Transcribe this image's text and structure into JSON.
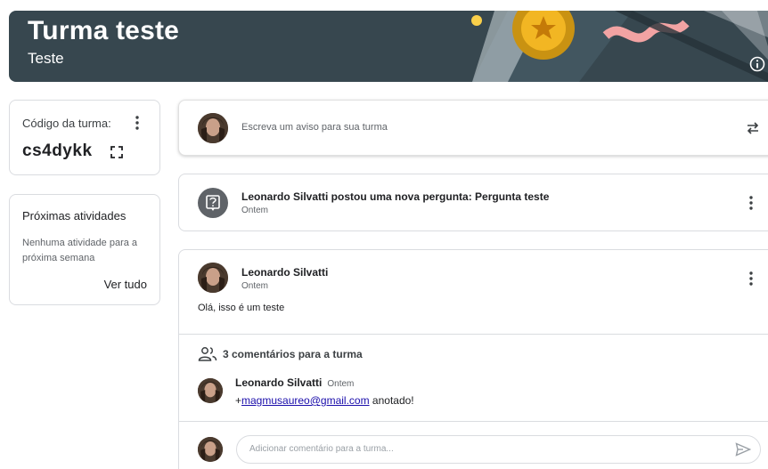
{
  "banner": {
    "title": "Turma teste",
    "subtitle": "Teste",
    "colors": {
      "background": "#37474f",
      "gold": "#e0a81f",
      "ribbon": "#f2a3a3"
    },
    "info_icon": "info-icon"
  },
  "class_code": {
    "label": "Código da turma:",
    "code": "cs4dykk",
    "icons": [
      "more-vert-icon",
      "fullscreen-icon"
    ]
  },
  "upcoming": {
    "label": "Próximas atividades",
    "empty_text": "Nenhuma atividade para a próxima semana",
    "see_all": "Ver tudo"
  },
  "share_box": {
    "placeholder": "Escreva um aviso para sua turma",
    "repost_icon": "repost-icon"
  },
  "question_post": {
    "text": "Leonardo Silvatti postou uma nova pergunta: Pergunta teste",
    "time": "Ontem",
    "icon": "question-icon"
  },
  "announcement": {
    "author": "Leonardo Silvatti",
    "time": "Ontem",
    "body": "Olá, isso é um teste",
    "comments_count_label": "3 comentários para a turma",
    "comment": {
      "author": "Leonardo Silvatti",
      "time": "Ontem",
      "prefix": "+",
      "mention": "magmusaureo@gmail.com",
      "suffix": " anotado!"
    },
    "comment_placeholder": "Adicionar comentário para a turma..."
  }
}
